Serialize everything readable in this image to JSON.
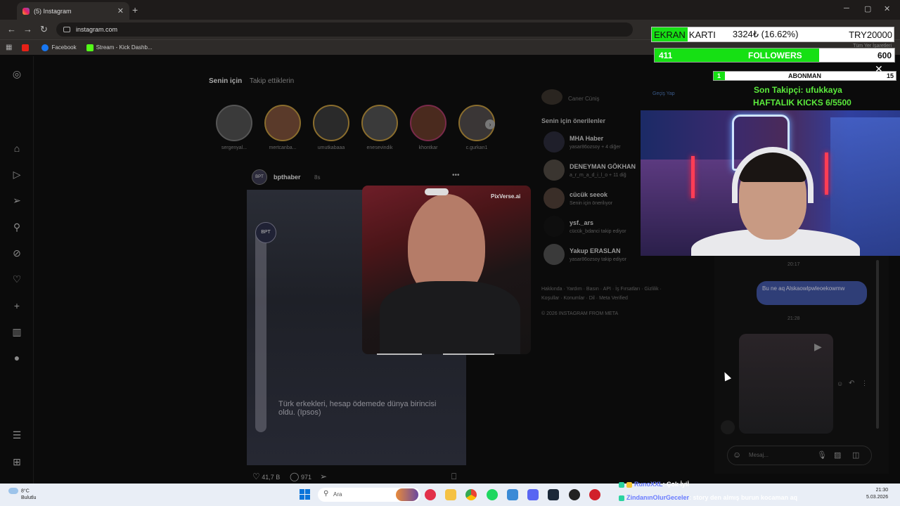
{
  "browser": {
    "tab_title": "(5) Instagram",
    "url": "instagram.com",
    "bookmarks": [
      "Facebook",
      "Stream - Kick Dashb..."
    ],
    "all_bookmarks": "Tüm Yer İşaretleri"
  },
  "feed": {
    "tabs": [
      "Senin için",
      "Takip ettiklerin"
    ],
    "stories": [
      "sergenyal...",
      "mertcanba...",
      "umutkabaaa",
      "enesevindik",
      "khontkar",
      "c.gurkan1"
    ],
    "post": {
      "user": "bpthaber",
      "age": "8s",
      "logo": "BPT",
      "caption": "Türk erkekleri, hesap ödemede dünya birincisi oldu. (Ipsos)",
      "likes": "41,7 B",
      "comments": "971"
    },
    "overlay_label": "PixVerse.ai"
  },
  "suggestions": {
    "top_user": "Caner Cüniş",
    "switch": "Geçiş Yap",
    "title": "Senin için önerilenler",
    "items": [
      {
        "name": "MHA Haber",
        "sub": "yasar86ozsoy + 4 diğer"
      },
      {
        "name": "DENEYMAN GÖKHAN",
        "sub": "a_r_m_a_d_i_l_o + 11 diğ"
      },
      {
        "name": "cücük seeok",
        "sub": "Senin için önerilıyor"
      },
      {
        "name": "ysf._ars",
        "sub": "cücük_bdanci takip ediyor"
      },
      {
        "name": "Yakup ERASLAN",
        "sub": "yasar86ozsoy takip ediyor"
      }
    ],
    "footer": "Hakkında · Yardım · Basın · API · İş Fırsatları · Gizlilik · Koşullar · Konumlar · Dil · Meta Verified",
    "copyright": "© 2026 INSTAGRAM FROM META"
  },
  "dm": {
    "time1": "20:17",
    "bubble": "Bu ne aq Alskaowlpwleoekowmw",
    "time2": "21:28",
    "placeholder": "Mesaj..."
  },
  "stream": {
    "ekran_label": "EKRAN",
    "ekran_label2": "KARTI",
    "ekran_value": "3324₺ (16.62%)",
    "ekran_goal": "TRY20000",
    "followers_current": "411",
    "followers_label": "FOLLOWERS",
    "followers_goal": "600",
    "followers_progress": 0.685,
    "abonman_current": "1",
    "abonman_label": "ABONMAN",
    "abonman_goal": "15",
    "son_takipci": "Son Takipçi: ufukkaya",
    "haftalik": "HAFTALIK KICKS 6/5500"
  },
  "chat": [
    {
      "user": "RunoXXL",
      "msg": ": Çok İyiİ"
    },
    {
      "user": "ZindanınOlurGeceler",
      "msg": ": story den almış burun kocaman aq"
    }
  ],
  "taskbar": {
    "temp": "8°C",
    "weather": "Bulutlu",
    "search": "Ara",
    "time": "21:30",
    "date": "5.03.2026"
  }
}
